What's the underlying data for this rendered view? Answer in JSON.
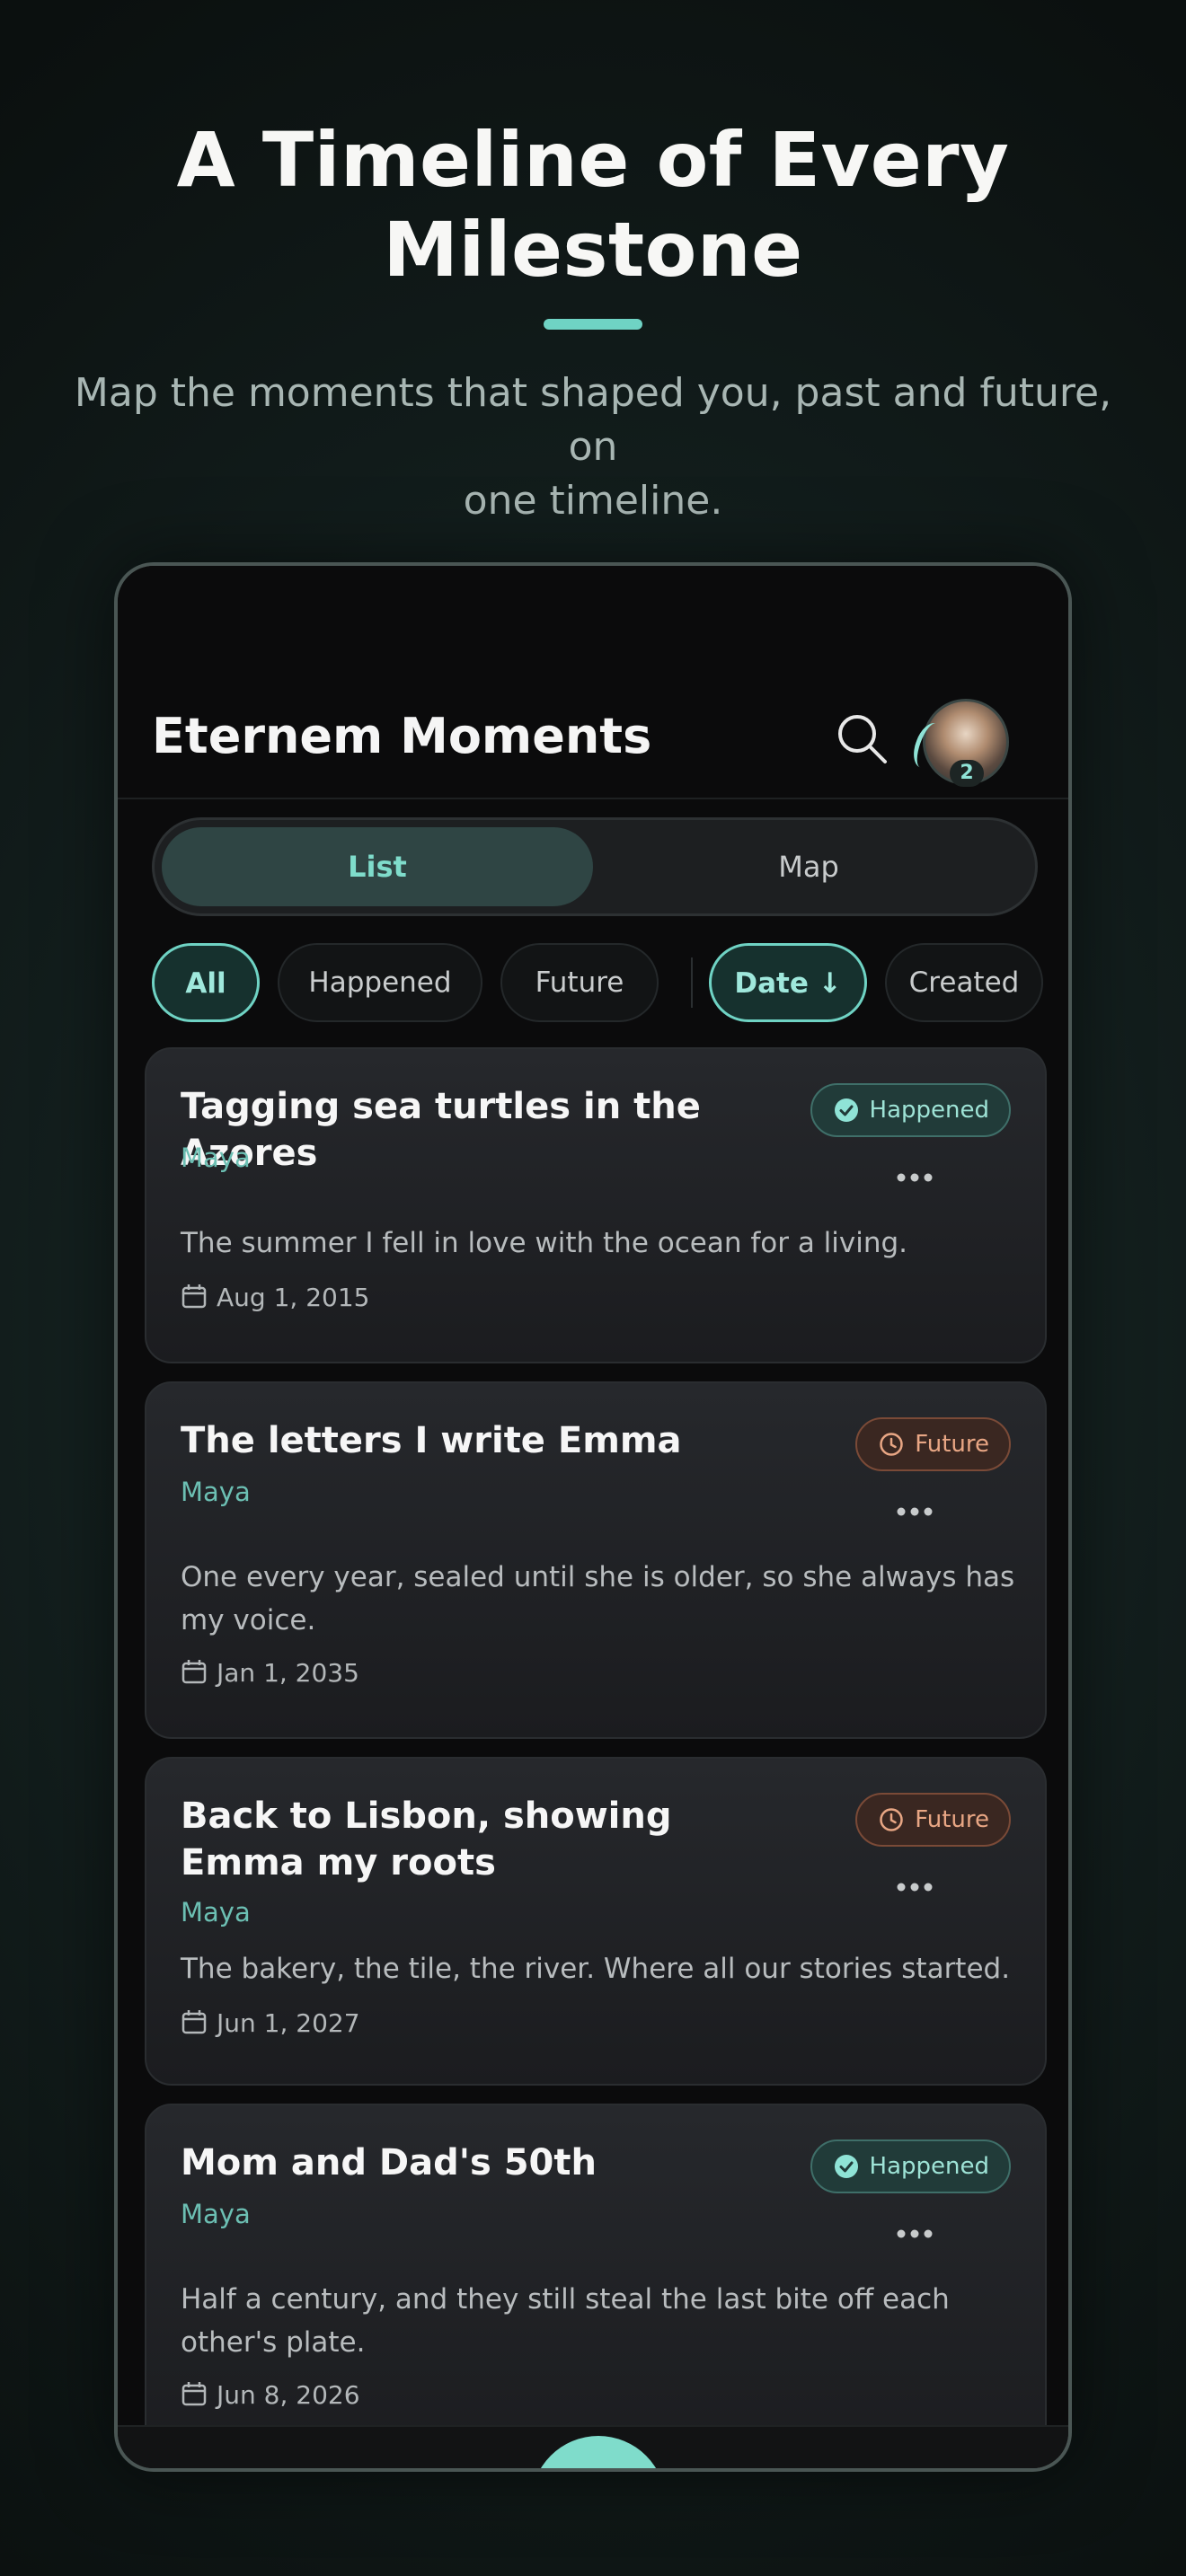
{
  "hero": {
    "headline_line1": "A Timeline of Every",
    "headline_line2": "Milestone",
    "subtitle_line1": "Map the moments that shaped you, past and future, on",
    "subtitle_line2": "one timeline."
  },
  "app": {
    "title": "Eternem Moments",
    "avatar_badge": "2",
    "accent": "#6fd3c4"
  },
  "segmented": {
    "list": "List",
    "map": "Map",
    "selected": "List"
  },
  "filters": {
    "all": "All",
    "happened": "Happened",
    "future": "Future",
    "date": "Date ↓",
    "created": "Created",
    "active_status": "All",
    "active_sort": "Date"
  },
  "moments": [
    {
      "title": "Tagging sea turtles in the Azores",
      "author": "Maya",
      "status": "Happened",
      "description": "The summer I fell in love with the ocean for a living.",
      "date": "Aug 1, 2015"
    },
    {
      "title": "The letters I write Emma",
      "author": "Maya",
      "status": "Future",
      "description": "One every year, sealed until she is older, so she always has my voice.",
      "date": "Jan 1, 2035"
    },
    {
      "title": "Back to Lisbon, showing Emma my roots",
      "author": "Maya",
      "status": "Future",
      "description": "The bakery, the tile, the river. Where all our stories started.",
      "date": "Jun 1, 2027"
    },
    {
      "title": "Mom and Dad's 50th",
      "author": "Maya",
      "status": "Happened",
      "description": "Half a century, and they still steal the last bite off each other's plate.",
      "date": "Jun 8, 2026"
    }
  ],
  "colors": {
    "happened": "#9ee3d6",
    "future": "#e8a684",
    "author": "#6cbfb3"
  }
}
